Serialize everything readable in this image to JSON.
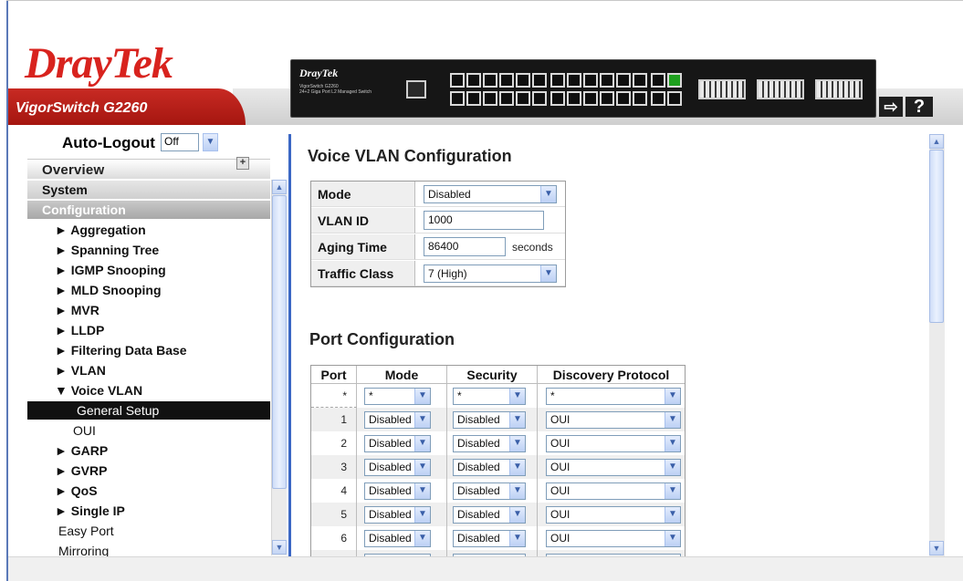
{
  "header": {
    "brand_dray": "Dray",
    "brand_tek": "Tek",
    "model": "VigorSwitch G2260",
    "device": {
      "brand": "DrayTek",
      "sub_line1": "VigorSwitch G2260",
      "sub_line2": "24+2 Giga Port L2 Managed Switch"
    },
    "logout_icon": "logout-arrow-icon",
    "help_label": "?"
  },
  "sidebar": {
    "autologout_label": "Auto-Logout",
    "autologout_value": "Off",
    "overview_label": "Overview",
    "items": [
      {
        "label": "System",
        "kind": "section"
      },
      {
        "label": "Configuration",
        "kind": "section-active"
      },
      {
        "label": "► Aggregation",
        "kind": "group"
      },
      {
        "label": "► Spanning Tree",
        "kind": "group"
      },
      {
        "label": "► IGMP Snooping",
        "kind": "group"
      },
      {
        "label": "► MLD Snooping",
        "kind": "group"
      },
      {
        "label": "► MVR",
        "kind": "group"
      },
      {
        "label": "► LLDP",
        "kind": "group"
      },
      {
        "label": "► Filtering Data Base",
        "kind": "group"
      },
      {
        "label": "► VLAN",
        "kind": "group"
      },
      {
        "label": "▼ Voice VLAN",
        "kind": "group"
      },
      {
        "label": "General Setup",
        "kind": "selected"
      },
      {
        "label": "OUI",
        "kind": "sub"
      },
      {
        "label": "► GARP",
        "kind": "group"
      },
      {
        "label": "► GVRP",
        "kind": "group"
      },
      {
        "label": "► QoS",
        "kind": "group"
      },
      {
        "label": "► Single IP",
        "kind": "group"
      },
      {
        "label": "Easy Port",
        "kind": "plain"
      },
      {
        "label": "Mirroring",
        "kind": "plain"
      }
    ]
  },
  "voice_vlan": {
    "title": "Voice VLAN Configuration",
    "mode_label": "Mode",
    "mode_value": "Disabled",
    "vlan_id_label": "VLAN ID",
    "vlan_id_value": "1000",
    "aging_time_label": "Aging Time",
    "aging_time_value": "86400",
    "aging_time_unit": "seconds",
    "traffic_class_label": "Traffic Class",
    "traffic_class_value": "7 (High)"
  },
  "port_config": {
    "title": "Port Configuration",
    "headers": [
      "Port",
      "Mode",
      "Security",
      "Discovery Protocol"
    ],
    "rows": [
      {
        "port": "*",
        "mode": "*",
        "security": "*",
        "discovery": "*"
      },
      {
        "port": "1",
        "mode": "Disabled",
        "security": "Disabled",
        "discovery": "OUI"
      },
      {
        "port": "2",
        "mode": "Disabled",
        "security": "Disabled",
        "discovery": "OUI"
      },
      {
        "port": "3",
        "mode": "Disabled",
        "security": "Disabled",
        "discovery": "OUI"
      },
      {
        "port": "4",
        "mode": "Disabled",
        "security": "Disabled",
        "discovery": "OUI"
      },
      {
        "port": "5",
        "mode": "Disabled",
        "security": "Disabled",
        "discovery": "OUI"
      },
      {
        "port": "6",
        "mode": "Disabled",
        "security": "Disabled",
        "discovery": "OUI"
      },
      {
        "port": "",
        "mode": "",
        "security": "",
        "discovery": ""
      }
    ]
  },
  "colors": {
    "brand_red": "#d8231e",
    "nav_selected": "#111111",
    "divider_blue": "#3b67c4"
  }
}
